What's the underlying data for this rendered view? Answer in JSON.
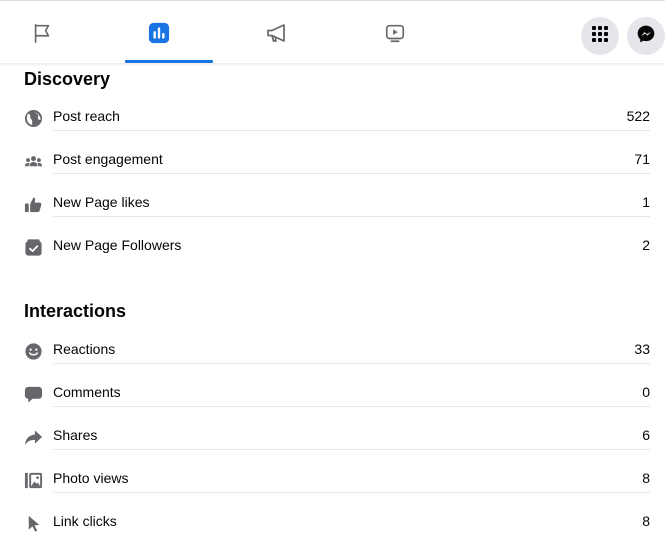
{
  "nav": {
    "tabs": [
      {
        "name": "flag-tab",
        "icon": "flag-icon"
      },
      {
        "name": "insights-tab",
        "icon": "bar-chart-icon",
        "active": true
      },
      {
        "name": "ads-tab",
        "icon": "megaphone-icon"
      },
      {
        "name": "video-tab",
        "icon": "play-icon"
      }
    ],
    "actions": [
      "menu-grid-icon",
      "messenger-icon"
    ],
    "accent_color": "#1b74e4"
  },
  "discovery": {
    "title": "Discovery",
    "rows": [
      {
        "label": "Post reach",
        "value": "522",
        "icon": "globe-icon"
      },
      {
        "label": "Post engagement",
        "value": "71",
        "icon": "people-icon"
      },
      {
        "label": "New Page likes",
        "value": "1",
        "icon": "thumbs-up-icon"
      },
      {
        "label": "New Page Followers",
        "value": "2",
        "icon": "follow-icon"
      }
    ]
  },
  "interactions": {
    "title": "Interactions",
    "rows": [
      {
        "label": "Reactions",
        "value": "33",
        "icon": "smiley-icon"
      },
      {
        "label": "Comments",
        "value": "0",
        "icon": "comment-icon"
      },
      {
        "label": "Shares",
        "value": "6",
        "icon": "share-icon"
      },
      {
        "label": "Photo views",
        "value": "8",
        "icon": "photo-icon"
      },
      {
        "label": "Link clicks",
        "value": "8",
        "icon": "cursor-icon"
      }
    ]
  }
}
